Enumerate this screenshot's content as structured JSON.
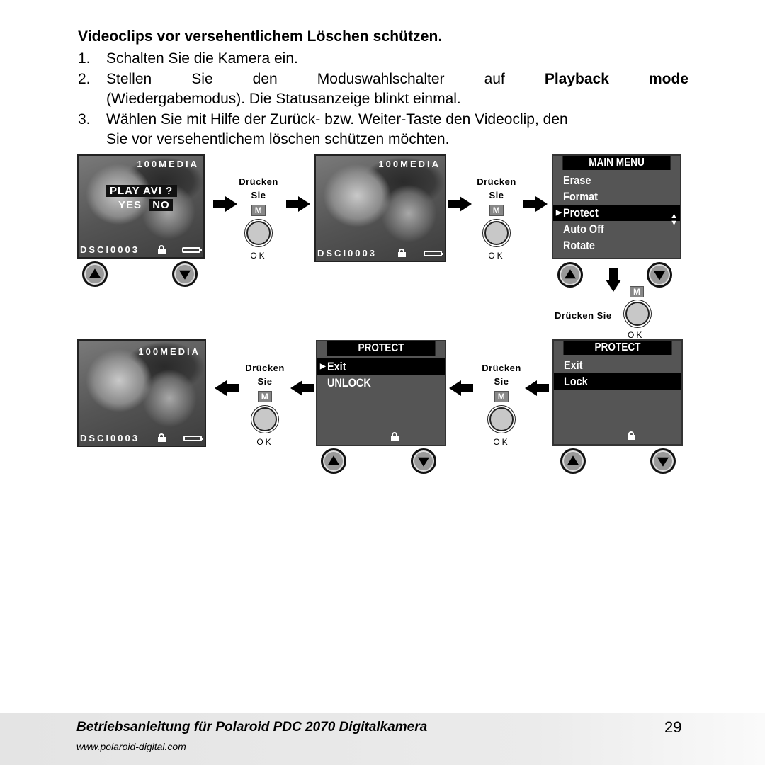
{
  "heading": "Videoclips vor versehentlichem Löschen schützen.",
  "steps": [
    {
      "num": "1.",
      "text": "Schalten Sie die Kamera ein."
    },
    {
      "num": "2.",
      "line1_words": [
        "Stellen",
        "Sie",
        "den",
        "Moduswahlschalter",
        "auf"
      ],
      "bold": [
        "Playback",
        "mode"
      ],
      "line2": "(Wiedergabemodus). Die Statusanzeige blinkt einmal."
    },
    {
      "num": "3.",
      "line1": "Wählen Sie mit Hilfe der Zurück- bzw. Weiter-Taste den Videoclip, den",
      "line2": "Sie vor versehentlichem löschen schützen möchten."
    }
  ],
  "screens": {
    "playback_prompt": {
      "folder": "100MEDIA",
      "prompt": "PLAY AVI ?",
      "yes": "YES",
      "no": "NO",
      "file": "DSCI0003"
    },
    "playback": {
      "folder": "100MEDIA",
      "file": "DSCI0003"
    },
    "main_menu": {
      "title": "MAIN MENU",
      "items": [
        "Erase",
        "Format",
        "Protect",
        "Auto Off",
        "Rotate"
      ],
      "selected": "Protect"
    },
    "protect_lock": {
      "title": "PROTECT",
      "items": [
        "Exit",
        "Lock"
      ],
      "selected": "Lock"
    },
    "protect_unlock": {
      "title": "PROTECT",
      "items": [
        "Exit",
        "UNLOCK"
      ],
      "selected": "Exit"
    },
    "playback_locked": {
      "folder": "100MEDIA",
      "file": "DSCI0003"
    }
  },
  "press": {
    "line1": "Drücken",
    "line2": "Sie",
    "inline": "Drücken Sie",
    "m_badge": "M",
    "ok": "OK"
  },
  "icons": {
    "up": "up-triangle-icon",
    "down": "down-triangle-icon",
    "lock": "lock-icon",
    "battery": "battery-icon",
    "scroll": "scroll-arrows-icon"
  },
  "footer": {
    "title": "Betriebsanleitung für Polaroid PDC 2070 Digitalkamera",
    "url": "www.polaroid-digital.com",
    "page": "29"
  }
}
